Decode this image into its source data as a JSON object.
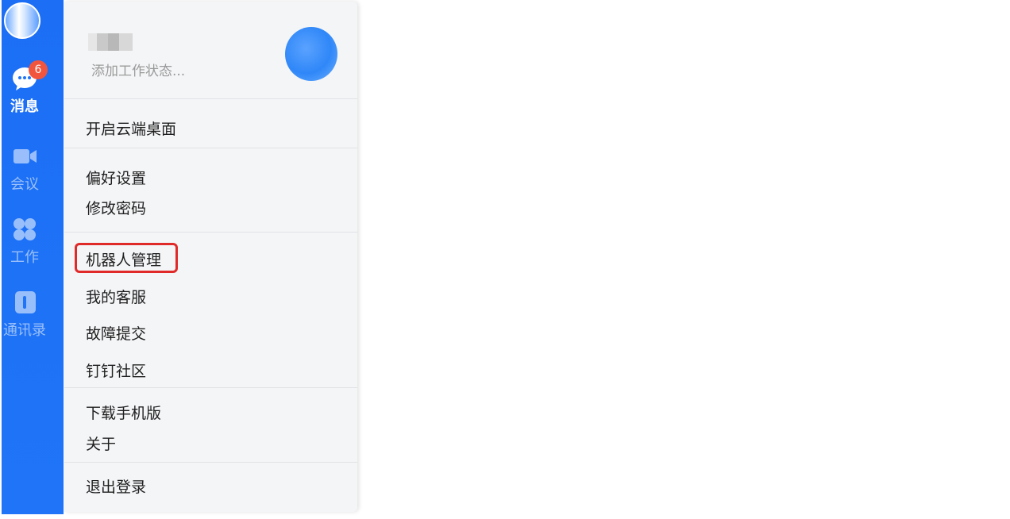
{
  "nav": {
    "items": [
      {
        "label": "消息",
        "icon": "chat-bubble-icon",
        "active": true,
        "badge": "6"
      },
      {
        "label": "会议",
        "icon": "video-camera-icon",
        "active": false
      },
      {
        "label": "工作",
        "icon": "apps-grid-icon",
        "active": false
      },
      {
        "label": "通讯录",
        "icon": "contacts-book-icon",
        "active": false
      }
    ]
  },
  "profile": {
    "status_placeholder": "添加工作状态..."
  },
  "menu": {
    "group1": [
      "开启云端桌面"
    ],
    "group2": [
      "偏好设置",
      "修改密码"
    ],
    "group3": [
      "机器人管理",
      "我的客服",
      "故障提交",
      "钉钉社区"
    ],
    "group4": [
      "下载手机版",
      "关于"
    ],
    "group5": [
      "退出登录"
    ]
  },
  "colors": {
    "rail": "#1c6ff5",
    "badge": "#f2553d",
    "highlight": "#e02a2a"
  }
}
